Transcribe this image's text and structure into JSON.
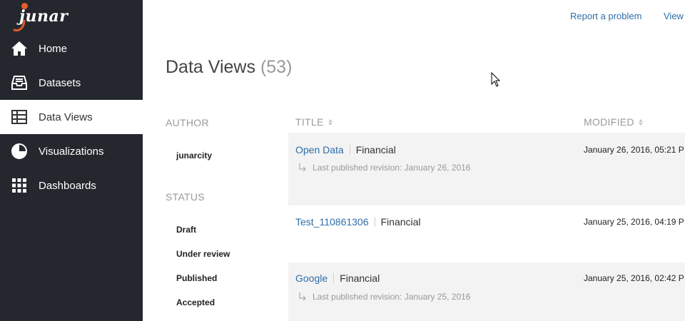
{
  "app": {
    "logo_text": "junar"
  },
  "sidebar": {
    "items": [
      {
        "label": "Home",
        "icon": "home-icon"
      },
      {
        "label": "Datasets",
        "icon": "inbox-icon"
      },
      {
        "label": "Data Views",
        "icon": "table-icon",
        "active": true
      },
      {
        "label": "Visualizations",
        "icon": "pie-chart-icon"
      },
      {
        "label": "Dashboards",
        "icon": "grid-icon"
      }
    ]
  },
  "header": {
    "links": [
      "Report a problem",
      "View"
    ]
  },
  "main": {
    "title": "Data Views",
    "count": "(53)",
    "filters": {
      "author_heading": "AUTHOR",
      "authors": [
        "junarcity"
      ],
      "status_heading": "STATUS",
      "statuses": [
        "Draft",
        "Under review",
        "Published",
        "Accepted"
      ]
    },
    "columns": {
      "title": "TITLE",
      "modified": "MODIFIED"
    },
    "rows": [
      {
        "name": "Open Data",
        "category": "Financial",
        "revision": "Last published revision: January 26, 2016",
        "modified": "January 26, 2016, 05:21 P"
      },
      {
        "name": "Test_110861306",
        "category": "Financial",
        "revision": "",
        "modified": "January 25, 2016, 04:19 P"
      },
      {
        "name": "Google",
        "category": "Financial",
        "revision": "Last published revision: January 25, 2016",
        "modified": "January 25, 2016, 02:42 P"
      }
    ]
  },
  "colors": {
    "sidebar_bg": "#24272d",
    "link": "#2e6ea9",
    "logo_accent": "#e35d2c",
    "row_shade": "#f3f3f3"
  }
}
